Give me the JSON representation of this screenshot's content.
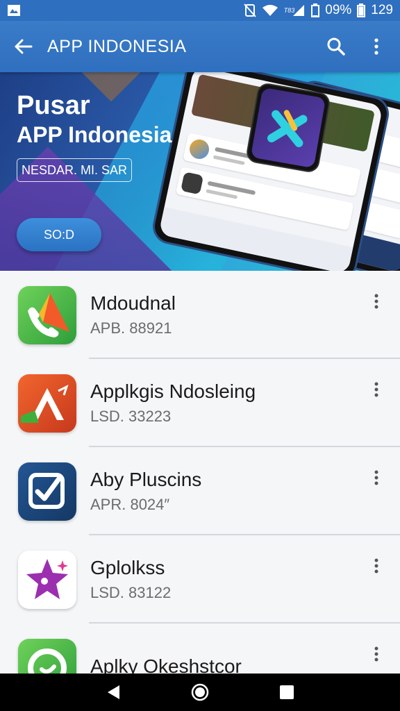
{
  "status_bar": {
    "network_label": "T83",
    "battery_text": "09%",
    "time": "129"
  },
  "app_bar": {
    "title": "APP INDONESIA",
    "icons": [
      "back-arrow-icon",
      "search-icon",
      "more-vert-icon"
    ]
  },
  "banner": {
    "title_line1": "Pusar",
    "title_line2": "APP Indonesia",
    "tag": "NESDAR. MI. SAR",
    "button_label": "SO:D"
  },
  "apps": [
    {
      "name": "Mdoudnal",
      "meta": "APB. 88921",
      "icon": "phone-arrow-app-icon",
      "colors": [
        "#5cc84a",
        "#2f9e3a"
      ]
    },
    {
      "name": "Applkgis Ndosleing",
      "meta": "LSD. 33223",
      "icon": "triangle-app-icon",
      "colors": [
        "#e8562a",
        "#c43a1f"
      ]
    },
    {
      "name": "Aby Pluscins",
      "meta": "APR. 8024″",
      "icon": "checkbox-app-icon",
      "colors": [
        "#1f4d86",
        "#163a66"
      ]
    },
    {
      "name": "Gplolkss",
      "meta": "LSD. 83122",
      "icon": "star-app-icon",
      "colors": [
        "#ffffff",
        "#ffffff"
      ]
    },
    {
      "name": "Aplky Okeshstcor",
      "meta": "",
      "icon": "chat-app-icon",
      "colors": [
        "#5cc84a",
        "#2f9e3a"
      ]
    }
  ],
  "nav_bar": {
    "icons": [
      "back-triangle-icon",
      "home-circle-icon",
      "recents-square-icon"
    ]
  }
}
